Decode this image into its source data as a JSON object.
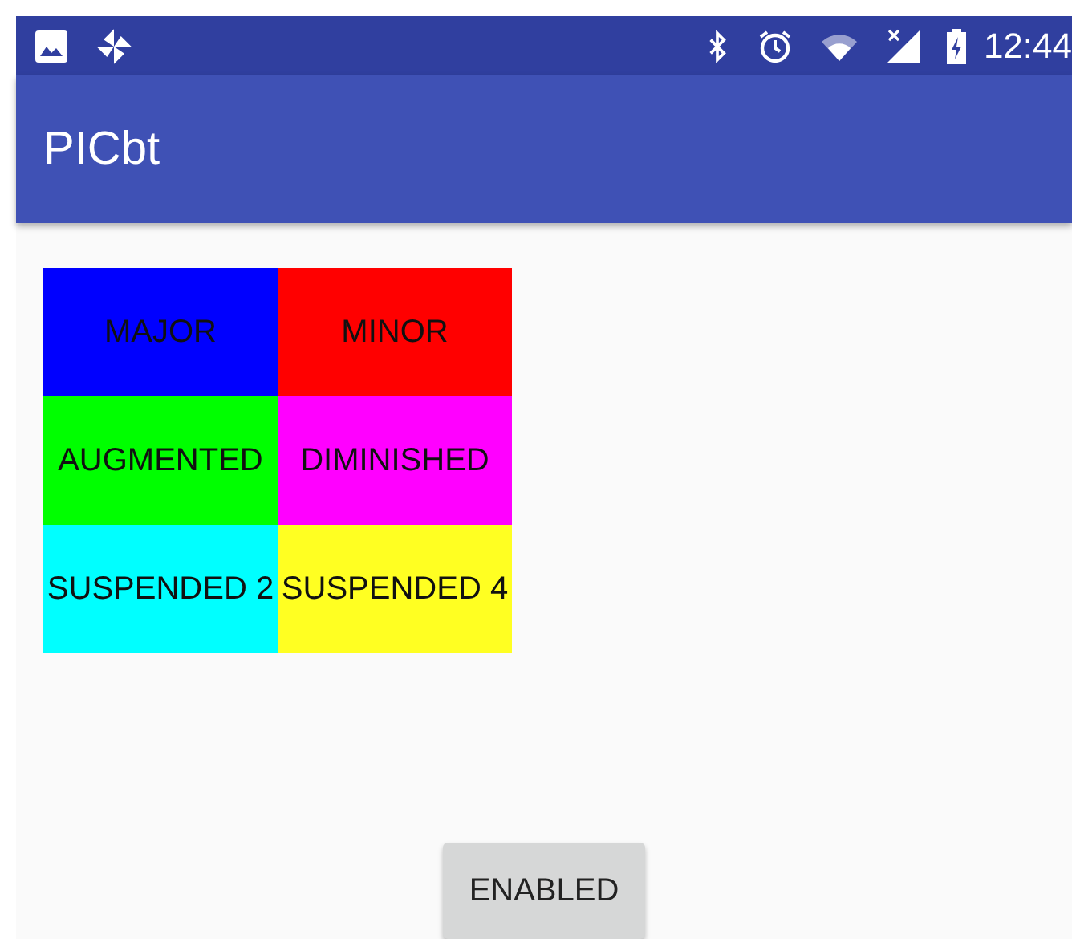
{
  "status_bar": {
    "time": "12:44"
  },
  "app_bar": {
    "title": "PICbt"
  },
  "chord_rows": [
    {
      "buttons": [
        {
          "label": "MAJOR",
          "color": "#0000ff"
        },
        {
          "label": "MINOR",
          "color": "#ff0000"
        }
      ]
    },
    {
      "buttons": [
        {
          "label": "AUGMENTED",
          "color": "#00ff00"
        },
        {
          "label": "DIMINISHED",
          "color": "#ff00ff"
        }
      ]
    },
    {
      "buttons": [
        {
          "label": "SUSPENDED 2",
          "color": "#00ffff"
        },
        {
          "label": "SUSPENDED 4",
          "color": "#ffff22"
        }
      ]
    }
  ],
  "toggle_button": {
    "label": "ENABLED"
  }
}
